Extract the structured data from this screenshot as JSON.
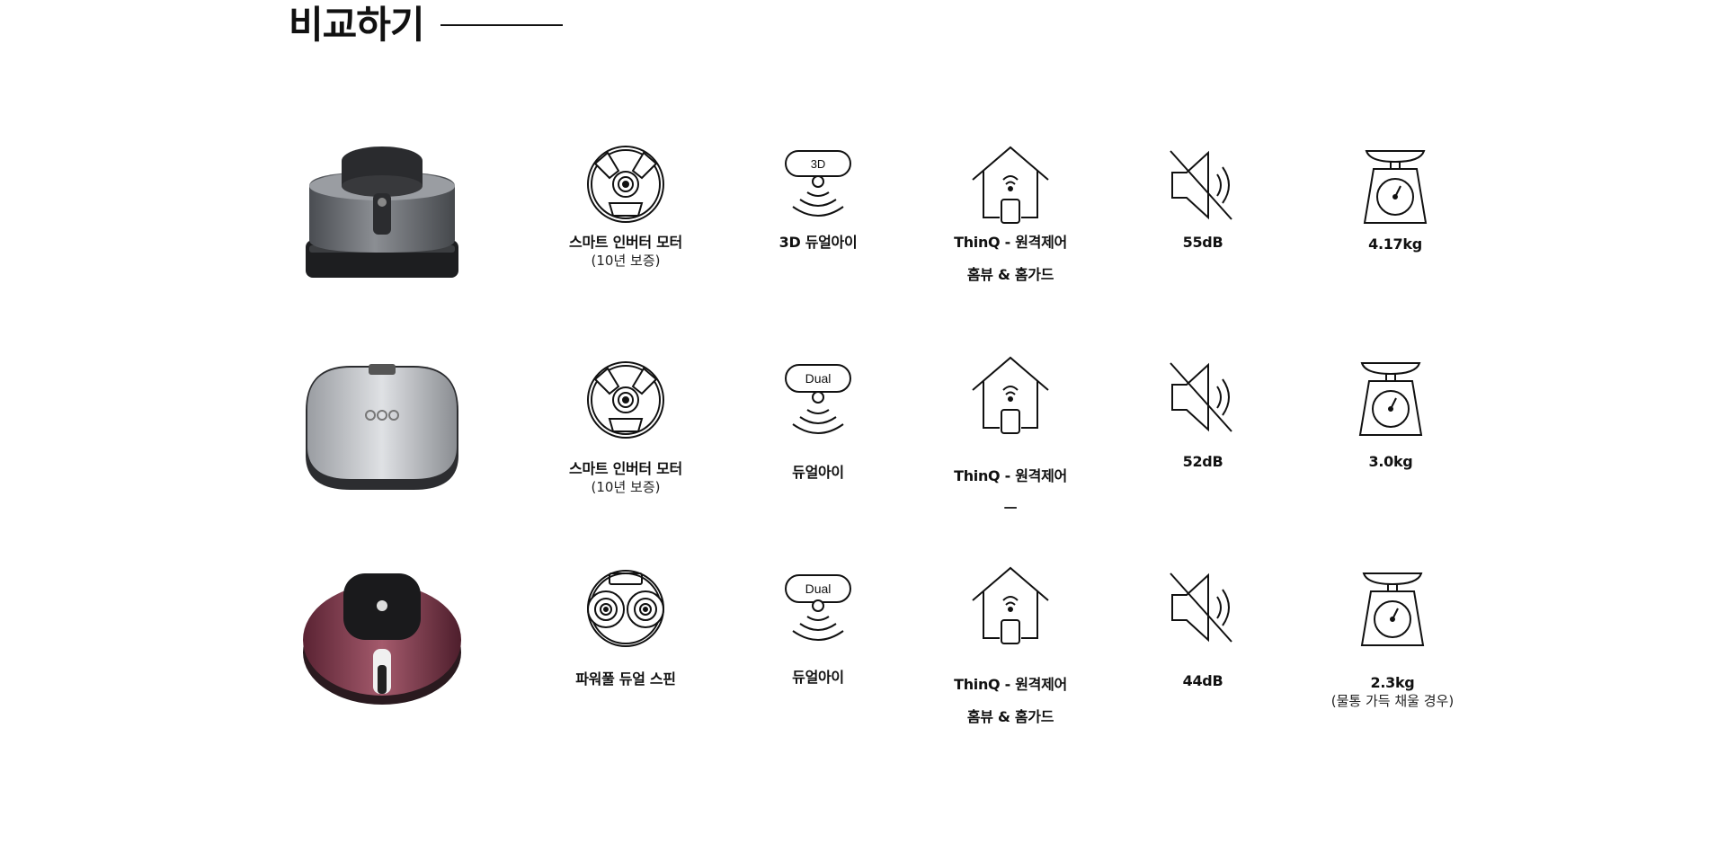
{
  "section": {
    "title": "비교하기"
  },
  "rows": [
    {
      "product": "robot-vacuum-r9-gray",
      "motor": {
        "label": "스마트 인버터 모터",
        "sub": "(10년 보증)",
        "icon": "inverter-motor-icon"
      },
      "eye": {
        "badge": "3D",
        "label": "3D 듀얼아이",
        "icon": "sensor-eye-icon"
      },
      "remote": {
        "label": "ThinQ - 원격제어",
        "sub": "홈뷰 & 홈가드",
        "icon": "home-remote-icon"
      },
      "noise": {
        "label": "55dB",
        "icon": "mute-speaker-icon"
      },
      "weight": {
        "label": "4.17kg",
        "sub": "",
        "icon": "scale-icon"
      }
    },
    {
      "product": "robot-vacuum-square-silver",
      "motor": {
        "label": "스마트 인버터 모터",
        "sub": "(10년 보증)",
        "icon": "inverter-motor-icon"
      },
      "eye": {
        "badge": "Dual",
        "label": "듀얼아이",
        "icon": "sensor-eye-icon"
      },
      "remote": {
        "label": "ThinQ - 원격제어",
        "sub": "ㅡ",
        "icon": "home-remote-icon"
      },
      "noise": {
        "label": "52dB",
        "icon": "mute-speaker-icon"
      },
      "weight": {
        "label": "3.0kg",
        "sub": "",
        "icon": "scale-icon"
      }
    },
    {
      "product": "robot-mop-burgundy",
      "motor": {
        "label": "파워풀 듀얼 스핀",
        "sub": "",
        "icon": "dual-spin-icon"
      },
      "eye": {
        "badge": "Dual",
        "label": "듀얼아이",
        "icon": "sensor-eye-icon"
      },
      "remote": {
        "label": "ThinQ - 원격제어",
        "sub": "홈뷰 & 홈가드",
        "icon": "home-remote-icon"
      },
      "noise": {
        "label": "44dB",
        "icon": "mute-speaker-icon"
      },
      "weight": {
        "label": "2.3kg",
        "sub": "(물통 가득 채울 경우)",
        "icon": "scale-icon"
      }
    }
  ]
}
